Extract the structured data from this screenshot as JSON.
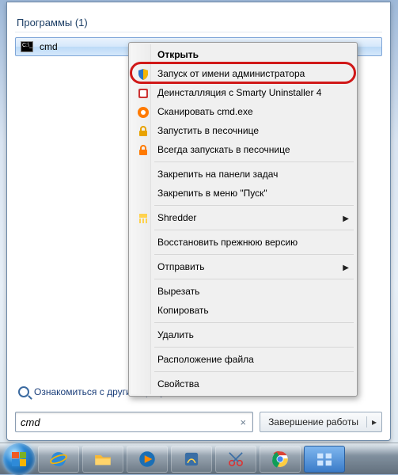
{
  "header": {
    "label": "Программы (1)"
  },
  "result": {
    "name": "cmd"
  },
  "see_more": "Ознакомиться с другими результатами",
  "search": {
    "value": "cmd",
    "clear": "×"
  },
  "shutdown": {
    "label": "Завершение работы",
    "arrow": "▸"
  },
  "menu": {
    "open": "Открыть",
    "run_as_admin": "Запуск от имени администратора",
    "smarty_uninstall": "Деинсталляция с Smarty Uninstaller 4",
    "scan": "Сканировать cmd.exe",
    "run_sandbox": "Запустить в песочнице",
    "always_sandbox": "Всегда запускать в песочнице",
    "pin_taskbar": "Закрепить на панели задач",
    "pin_start": "Закрепить в меню \"Пуск\"",
    "shredder": "Shredder",
    "restore_prev": "Восстановить прежнюю версию",
    "send_to": "Отправить",
    "cut": "Вырезать",
    "copy": "Копировать",
    "delete": "Удалить",
    "open_location": "Расположение файла",
    "properties": "Свойства",
    "submenu_arrow": "▶"
  },
  "icons": {
    "shield": "shield-icon",
    "uninstaller": "uninstaller-icon",
    "avast": "avast-icon",
    "lock": "lock-icon",
    "lock_orange": "lock-orange-icon",
    "shredder": "shredder-icon"
  }
}
